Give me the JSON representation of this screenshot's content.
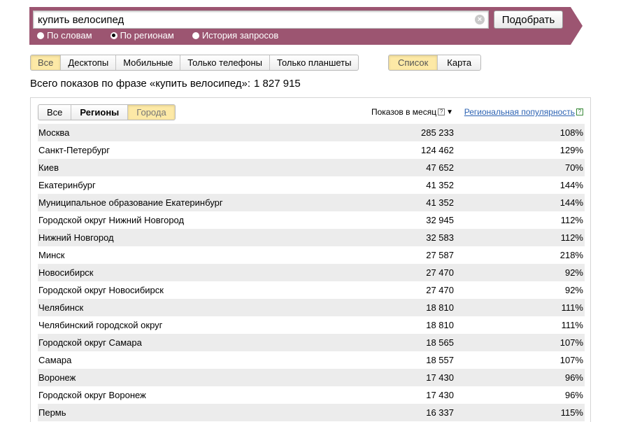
{
  "search": {
    "value": "купить велосипед",
    "clear_symbol": "×",
    "submit_label": "Подобрать",
    "modes": [
      {
        "label": "По словам",
        "checked": false
      },
      {
        "label": "По регионам",
        "checked": true
      },
      {
        "label": "История запросов",
        "checked": false
      }
    ]
  },
  "device_filter": [
    "Все",
    "Десктопы",
    "Мобильные",
    "Только телефоны",
    "Только планшеты"
  ],
  "view_filter": [
    "Список",
    "Карта"
  ],
  "total": {
    "label": "Всего показов по фразе «купить велосипед»:",
    "value": "1 827 915"
  },
  "table": {
    "tabs": [
      "Все",
      "Регионы",
      "Города"
    ],
    "col_count": "Показов в месяц",
    "col_pop": "Региональная популярность",
    "help_symbol": "?",
    "sort_symbol": "▼",
    "rows": [
      {
        "region": "Москва",
        "count": "285 233",
        "pop": "108%"
      },
      {
        "region": "Санкт-Петербург",
        "count": "124 462",
        "pop": "129%"
      },
      {
        "region": "Киев",
        "count": "47 652",
        "pop": "70%"
      },
      {
        "region": "Екатеринбург",
        "count": "41 352",
        "pop": "144%"
      },
      {
        "region": "Муниципальное образование Екатеринбург",
        "count": "41 352",
        "pop": "144%"
      },
      {
        "region": "Городской округ Нижний Новгород",
        "count": "32 945",
        "pop": "112%"
      },
      {
        "region": "Нижний Новгород",
        "count": "32 583",
        "pop": "112%"
      },
      {
        "region": "Минск",
        "count": "27 587",
        "pop": "218%"
      },
      {
        "region": "Новосибирск",
        "count": "27 470",
        "pop": "92%"
      },
      {
        "region": "Городской округ Новосибирск",
        "count": "27 470",
        "pop": "92%"
      },
      {
        "region": "Челябинск",
        "count": "18 810",
        "pop": "111%"
      },
      {
        "region": "Челябинский городской округ",
        "count": "18 810",
        "pop": "111%"
      },
      {
        "region": "Городской округ Самара",
        "count": "18 565",
        "pop": "107%"
      },
      {
        "region": "Самара",
        "count": "18 557",
        "pop": "107%"
      },
      {
        "region": "Воронеж",
        "count": "17 430",
        "pop": "96%"
      },
      {
        "region": "Городской округ Воронеж",
        "count": "17 430",
        "pop": "96%"
      },
      {
        "region": "Пермь",
        "count": "16 337",
        "pop": "115%"
      }
    ]
  }
}
